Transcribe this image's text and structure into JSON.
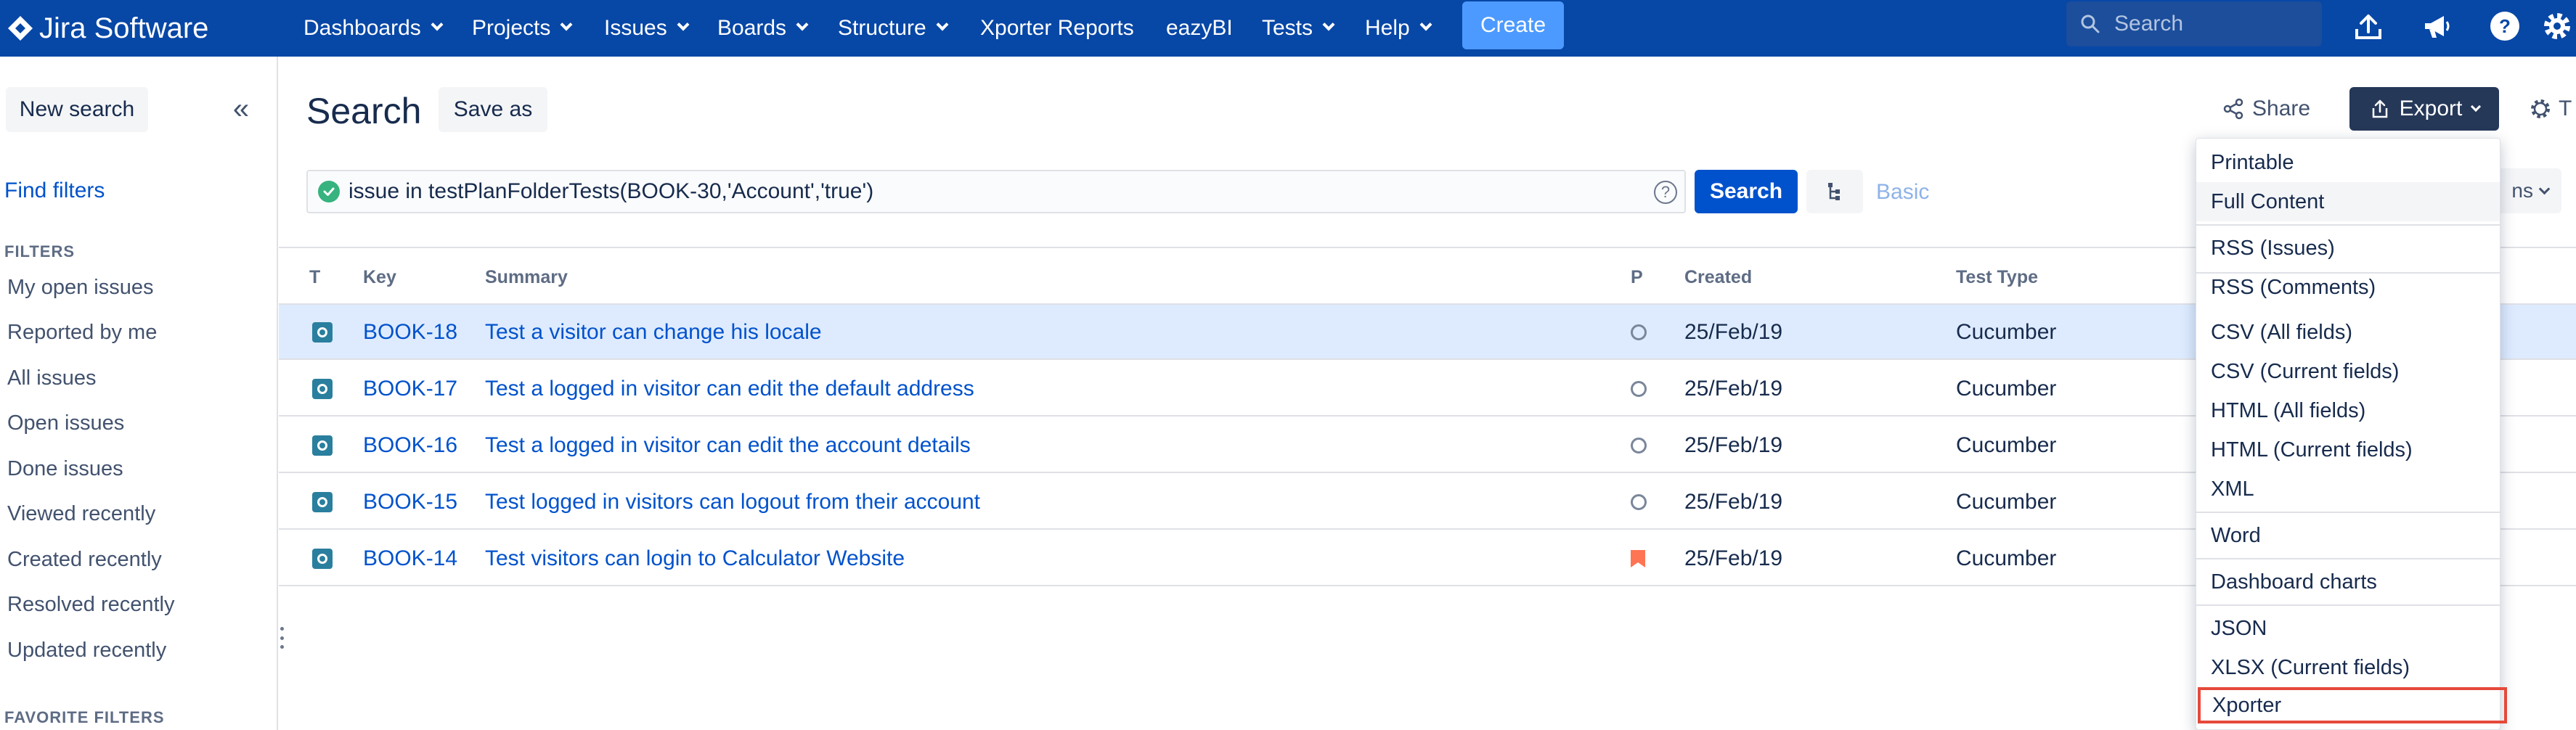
{
  "topnav": {
    "brand": "Jira Software",
    "items": [
      {
        "label": "Dashboards"
      },
      {
        "label": "Projects"
      },
      {
        "label": "Issues"
      },
      {
        "label": "Boards"
      },
      {
        "label": "Structure"
      },
      {
        "label": "Xporter Reports"
      },
      {
        "label": "eazyBI"
      },
      {
        "label": "Tests"
      },
      {
        "label": "Help"
      }
    ],
    "create_label": "Create",
    "search_placeholder": "Search"
  },
  "sidebar": {
    "new_search_label": "New search",
    "collapse_glyph": "«",
    "find_filters_label": "Find filters",
    "filters_heading": "FILTERS",
    "filters": [
      "My open issues",
      "Reported by me",
      "All issues",
      "Open issues",
      "Done issues",
      "Viewed recently",
      "Created recently",
      "Resolved recently",
      "Updated recently"
    ],
    "favorite_heading": "FAVORITE FILTERS"
  },
  "main": {
    "title": "Search",
    "save_as_label": "Save as",
    "share_label": "Share",
    "export_label": "Export",
    "tools_label": "T",
    "jql_query": "issue in testPlanFolderTests(BOOK-30,'Account','true')",
    "jql_help": "?",
    "search_button_label": "Search",
    "basic_label": "Basic",
    "columns_label": "ns"
  },
  "table": {
    "headers": {
      "type": "T",
      "key": "Key",
      "summary": "Summary",
      "priority": "P",
      "created": "Created",
      "test_type": "Test Type"
    },
    "rows": [
      {
        "key": "BOOK-18",
        "summary": "Test a visitor can change his locale",
        "priority": "circle",
        "created": "25/Feb/19",
        "test_type": "Cucumber",
        "selected": true
      },
      {
        "key": "BOOK-17",
        "summary": "Test a logged in visitor can edit the default address",
        "priority": "circle",
        "created": "25/Feb/19",
        "test_type": "Cucumber",
        "selected": false
      },
      {
        "key": "BOOK-16",
        "summary": "Test a logged in visitor can edit the account details",
        "priority": "circle",
        "created": "25/Feb/19",
        "test_type": "Cucumber",
        "selected": false
      },
      {
        "key": "BOOK-15",
        "summary": "Test logged in visitors can logout from their account",
        "priority": "circle",
        "created": "25/Feb/19",
        "test_type": "Cucumber",
        "selected": false
      },
      {
        "key": "BOOK-14",
        "summary": "Test visitors can login to Calculator Website",
        "priority": "flag",
        "created": "25/Feb/19",
        "test_type": "Cucumber",
        "selected": false
      }
    ]
  },
  "export_menu": {
    "groups": [
      [
        "Printable",
        "Full Content"
      ],
      [
        "RSS (Issues)",
        "RSS (Comments)"
      ],
      [
        "CSV (All fields)",
        "CSV (Current fields)",
        "HTML (All fields)",
        "HTML (Current fields)",
        "XML"
      ],
      [
        "Word"
      ],
      [
        "Dashboard charts"
      ],
      [
        "JSON",
        "XLSX (Current fields)",
        "Xporter"
      ]
    ],
    "hovered_item": "Full Content",
    "highlighted_item": "Xporter",
    "highlight_color": "#e5493a"
  },
  "colors": {
    "nav_bg": "#0747a6",
    "create_btn": "#4c9aff",
    "primary_btn": "#0052cc",
    "export_btn": "#253858",
    "selected_row": "#deebff",
    "priority_flag": "#ff7452",
    "test_icon": "#2a7f9e"
  }
}
